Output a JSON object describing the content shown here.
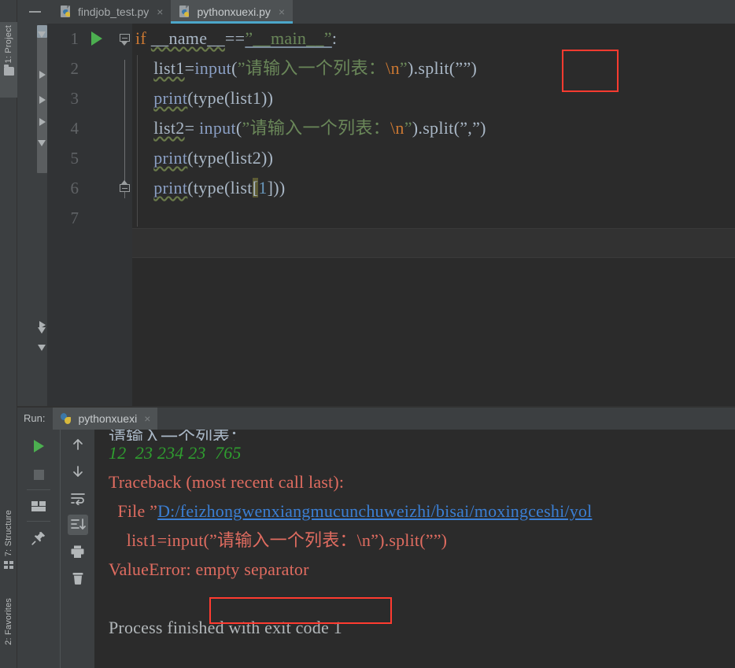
{
  "window": {
    "theme_bg": "#3c3f41",
    "editor_bg": "#2b2b2b",
    "accent": "#4ca6c9",
    "error_box_color": "#ff3b30"
  },
  "left_tool_strip": {
    "tabs": [
      {
        "label": "1: Project",
        "icon": "folder-icon",
        "active": true
      },
      {
        "label": "7: Structure",
        "icon": "structure-icon",
        "active": false
      },
      {
        "label": "2: Favorites",
        "icon": "none",
        "active": false
      }
    ]
  },
  "editor_tabs": {
    "collapse_button": "collapse-all-icon",
    "items": [
      {
        "label": "findjob_test.py",
        "icon": "python-file-icon",
        "close": "×",
        "active": false
      },
      {
        "label": "pythonxuexi.py",
        "icon": "python-file-icon",
        "close": "×",
        "active": true
      }
    ]
  },
  "editor": {
    "line_numbers": [
      "1",
      "2",
      "3",
      "4",
      "5",
      "6",
      "7"
    ],
    "caret_line": 7,
    "run_gutter_line": 1,
    "code_lines": [
      {
        "n": 1,
        "tokens": [
          {
            "t": "if ",
            "c": "kw"
          },
          {
            "t": "__name__",
            "c": "ident wavy"
          },
          {
            "t": "==",
            "c": "def"
          },
          {
            "t": "”__main__”",
            "c": "str solid-u"
          },
          {
            "t": ":",
            "c": "def"
          }
        ]
      },
      {
        "n": 2,
        "tokens": [
          {
            "t": "    ",
            "c": "def"
          },
          {
            "t": "list1",
            "c": "ident wavy"
          },
          {
            "t": "=",
            "c": "def"
          },
          {
            "t": "input",
            "c": "fn"
          },
          {
            "t": "(",
            "c": "def"
          },
          {
            "t": "”请输入一个列表：",
            "c": "str"
          },
          {
            "t": "\\n",
            "c": "esc"
          },
          {
            "t": "”",
            "c": "str"
          },
          {
            "t": ").split(””)",
            "c": "def"
          }
        ]
      },
      {
        "n": 3,
        "tokens": [
          {
            "t": "    ",
            "c": "def"
          },
          {
            "t": "print",
            "c": "fn wavy"
          },
          {
            "t": "(type(list1))",
            "c": "def"
          }
        ]
      },
      {
        "n": 4,
        "tokens": [
          {
            "t": "    ",
            "c": "def"
          },
          {
            "t": "list2",
            "c": "ident wavy"
          },
          {
            "t": "= ",
            "c": "def"
          },
          {
            "t": "input",
            "c": "fn"
          },
          {
            "t": "(",
            "c": "def"
          },
          {
            "t": "”请输入一个列表：",
            "c": "str"
          },
          {
            "t": "\\n",
            "c": "esc"
          },
          {
            "t": "”",
            "c": "str"
          },
          {
            "t": ").split(”,”)",
            "c": "def"
          }
        ]
      },
      {
        "n": 5,
        "tokens": [
          {
            "t": "    ",
            "c": "def"
          },
          {
            "t": "print",
            "c": "fn wavy"
          },
          {
            "t": "(type(list2))",
            "c": "def"
          }
        ]
      },
      {
        "n": 6,
        "tokens": [
          {
            "t": "    ",
            "c": "def"
          },
          {
            "t": "print",
            "c": "fn wavy"
          },
          {
            "t": "(type(list",
            "c": "def"
          },
          {
            "t": "[",
            "c": "brace-hl"
          },
          {
            "t": "1",
            "c": "num"
          },
          {
            "t": "])",
            "c": "def"
          },
          {
            "t": ")",
            "c": "def"
          }
        ]
      },
      {
        "n": 7,
        "tokens": []
      }
    ],
    "highlight_box_label": "split-empty-separator-highlight"
  },
  "run_window": {
    "label": "Run:",
    "tab": {
      "label": "pythonxuexi",
      "icon": "python-icon",
      "close": "×"
    },
    "toolbar_primary": [
      {
        "name": "rerun-button",
        "icon": "play-icon"
      },
      {
        "name": "stop-button",
        "icon": "stop-icon"
      },
      {
        "name": "layout-button",
        "icon": "layout-icon"
      },
      {
        "name": "pin-tab-button",
        "icon": "pin-icon"
      }
    ],
    "toolbar_secondary": [
      {
        "name": "up-button",
        "icon": "arrow-up-icon"
      },
      {
        "name": "down-button",
        "icon": "arrow-down-icon"
      },
      {
        "name": "soft-wrap-button",
        "icon": "soft-wrap-icon"
      },
      {
        "name": "scroll-to-end-button",
        "icon": "scroll-to-end-icon",
        "selected": true
      },
      {
        "name": "print-button",
        "icon": "printer-icon"
      },
      {
        "name": "clear-all-button",
        "icon": "trash-icon"
      }
    ]
  },
  "console": {
    "clipped_top_line": "请输入一个列表：",
    "lines": [
      {
        "kind": "input",
        "text": "12  23 234 23  765"
      },
      {
        "kind": "error",
        "text": "Traceback (most recent call last):"
      },
      {
        "kind": "error-link",
        "prefix": "  File ”",
        "link": "D:/feizhongwenxiangmucunchuweizhi/bisai/moxingceshi/yol"
      },
      {
        "kind": "error",
        "text": "    list1=input(”请输入一个列表：\\n”).split(””)"
      },
      {
        "kind": "error",
        "text": "ValueError: empty separator"
      },
      {
        "kind": "output",
        "text": "Process finished with exit code 1"
      }
    ],
    "error_highlight": "empty separator",
    "exit_code": "1"
  }
}
